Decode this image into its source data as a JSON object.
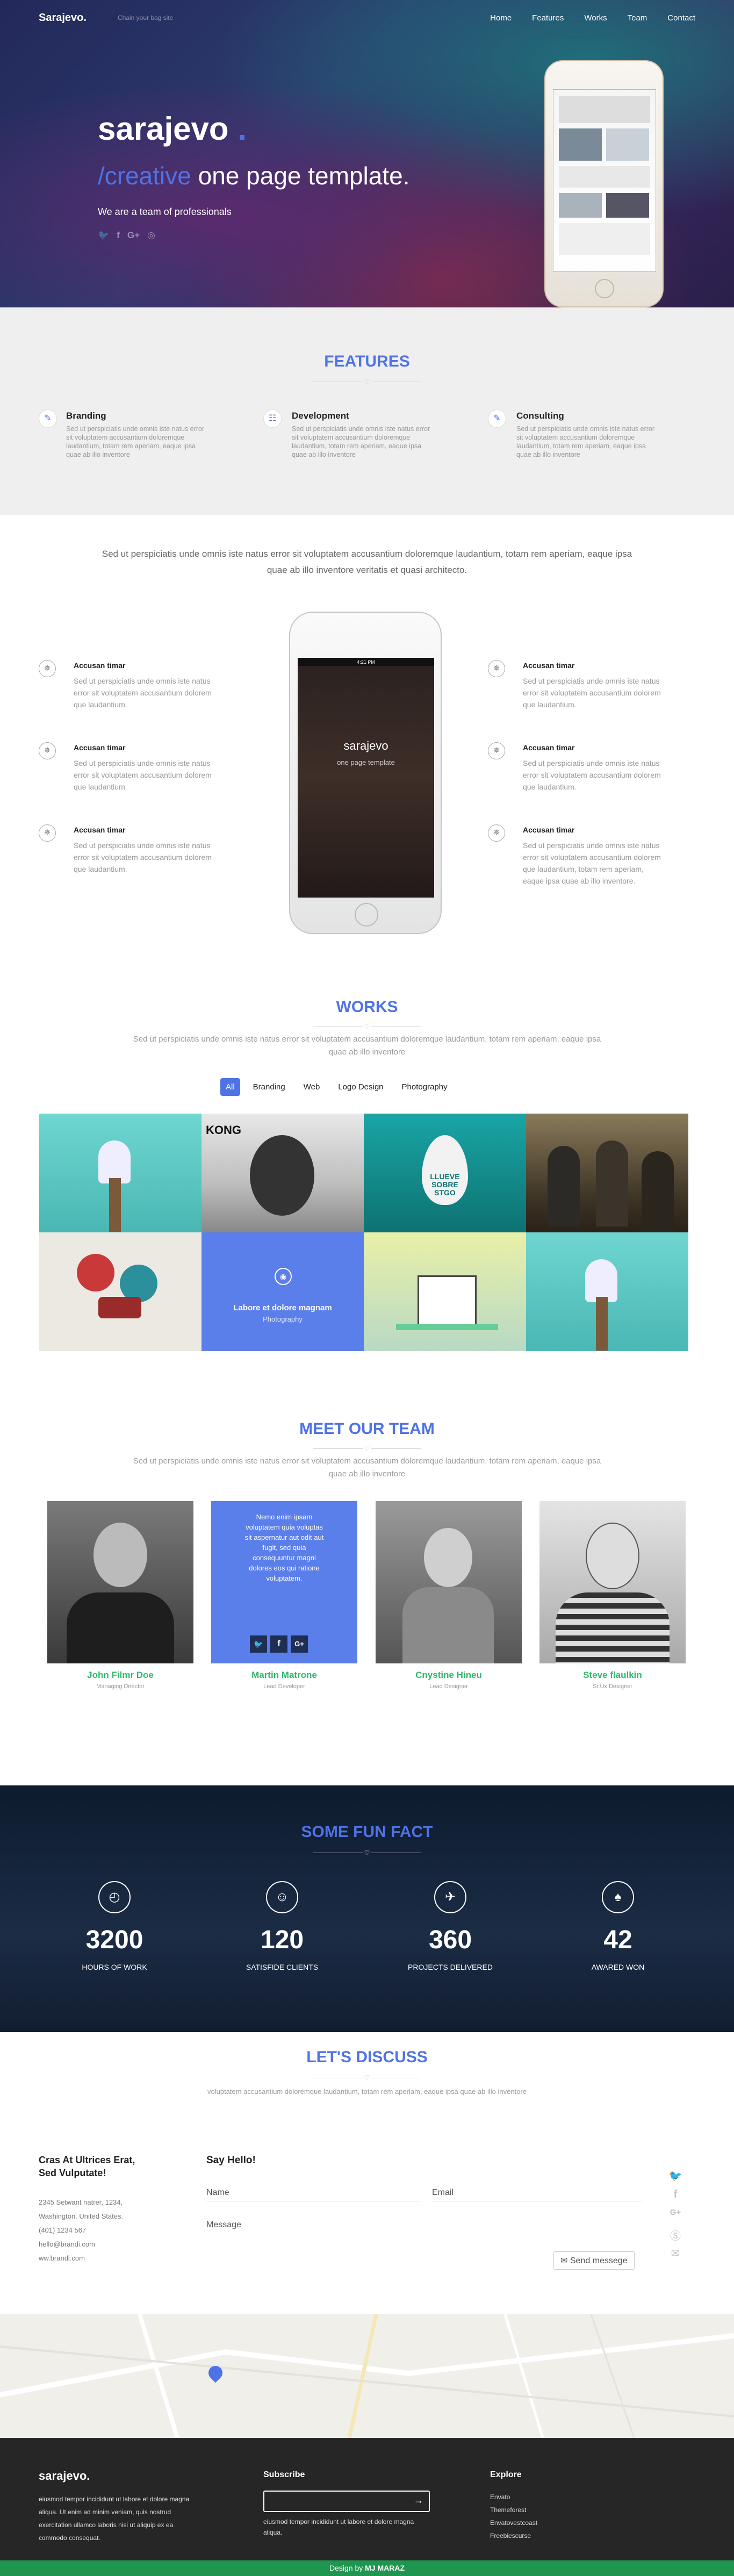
{
  "nav": {
    "brand": "Sarajevo.",
    "tagline": "Chain your bag site",
    "links": [
      "Home",
      "Features",
      "Works",
      "Team",
      "Contact"
    ]
  },
  "hero": {
    "title": "sarajevo",
    "title_dot": ".",
    "subtitle_accent": "/creative",
    "subtitle_rest": " one page template.",
    "tagline": "We are a team of professionals",
    "social_icons": [
      "twitter-icon",
      "facebook-icon",
      "google-plus-icon",
      "dribbble-icon"
    ]
  },
  "features": {
    "heading": "FEATURES",
    "items": [
      {
        "title": "Branding",
        "icon": "pencil-icon",
        "text": "Sed ut perspiciatis unde omnis iste natus error sit voluptatem accusantium doloremque laudantium, totam rem aperiam, eaque ipsa quae ab illo inventore"
      },
      {
        "title": "Development",
        "icon": "database-icon",
        "text": "Sed ut perspiciatis unde omnis iste natus error sit voluptatem accusantium doloremque laudantium, totam rem aperiam, eaque ipsa quae ab illo inventore"
      },
      {
        "title": "Consulting",
        "icon": "pencil-icon",
        "text": "Sed ut perspiciatis unde omnis iste natus error sit voluptatem accusantium doloremque laudantium, totam rem aperiam, eaque ipsa quae ab illo inventore"
      }
    ]
  },
  "showcase": {
    "intro": "Sed ut perspiciatis unde omnis iste natus error sit voluptatem accusantium doloremque laudantium, totam rem aperiam, eaque ipsa quae ab illo inventore veritatis et quasi architecto.",
    "phone_brand": "sarajevo",
    "phone_sub": "one page template",
    "left": [
      {
        "title": "Accusan timar",
        "text": "Sed ut perspiciatis unde omnis iste natus error sit voluptatem accusantium dolorem que laudantium."
      },
      {
        "title": "Accusan timar",
        "text": "Sed ut perspiciatis unde omnis iste natus error sit voluptatem accusantium dolorem que laudantium."
      },
      {
        "title": "Accusan timar",
        "text": "Sed ut perspiciatis unde omnis iste natus error sit voluptatem accusantium dolorem que laudantium."
      }
    ],
    "right": [
      {
        "title": "Accusan timar",
        "text": "Sed ut perspiciatis unde omnis iste natus error sit voluptatem accusantium dolorem que laudantium."
      },
      {
        "title": "Accusan timar",
        "text": "Sed ut perspiciatis unde omnis iste natus error sit voluptatem accusantium dolorem que laudantium."
      },
      {
        "title": "Accusan timar",
        "text": "Sed ut perspiciatis unde omnis iste natus error sit voluptatem accusantium dolorem que laudantium, totam rem aperiam, eaque ipsa quae ab illo inventore."
      }
    ]
  },
  "works": {
    "heading": "WORKS",
    "intro": "Sed ut perspiciatis unde omnis iste natus error sit voluptatem accusantium doloremque laudantium, totam rem aperiam, eaque ipsa quae ab illo inventore",
    "filters": [
      "All",
      "Branding",
      "Web",
      "Logo Design",
      "Photography"
    ],
    "hover_title": "Labore et dolore magnam",
    "hover_cat": "Photography",
    "tile_text_llueve": "LLUEVE SOBRE STGO"
  },
  "team": {
    "heading": "MEET OUR TEAM",
    "intro": "Sed ut perspiciatis unde omnis iste natus error sit voluptatem accusantium doloremque laudantium, totam rem aperiam, eaque ipsa quae ab illo inventore",
    "overlay_text": "Nemo enim ipsam voluptatem quia voluptas sit aspernatur aut odit aut fugit, sed quia consequuntur magni dolores eos qui ratione voluptatem.",
    "members": [
      {
        "name": "John Filmr Doe",
        "role": "Managing Director"
      },
      {
        "name": "Martin Matrone",
        "role": "Lead Developer"
      },
      {
        "name": "Cnystine Hineu",
        "role": "Lead Designer"
      },
      {
        "name": "Steve flaulkin",
        "role": "Sr.Ux Designer"
      }
    ]
  },
  "fact": {
    "heading": "SOME FUN FACT",
    "items": [
      {
        "icon": "clock-icon",
        "value": "3200",
        "label": "HOURS OF WORK"
      },
      {
        "icon": "user-icon",
        "value": "120",
        "label": "SATISFIDE CLIENTS"
      },
      {
        "icon": "rocket-icon",
        "value": "360",
        "label": "PROJECTS DELIVERED"
      },
      {
        "icon": "trophy-icon",
        "value": "42",
        "label": "AWARED WON"
      }
    ]
  },
  "contact": {
    "heading": "LET'S DISCUSS",
    "intro": "voluptatem accusantium doloremque laudantium, totam rem aperiam, eaque ipsa quae ab illo inventore",
    "company_line1": "Cras At Ultrices Erat,",
    "company_line2": "Sed Vulputate!",
    "address": [
      "2345 Setwant natrer, 1234,",
      "Washington. United States.",
      "(401) 1234 567",
      "hello@brandi.com",
      "ww.brandi.com"
    ],
    "form_title": "Say Hello!",
    "name_placeholder": "Name",
    "email_placeholder": "Email",
    "message_placeholder": "Message",
    "send_label": "Send messege"
  },
  "footer": {
    "brand": "sarajevo.",
    "about": "eiusmod tempor incididunt ut labore et dolore magna aliqua. Ut enim ad minim veniam, quis nostrud exercitation ullamco laboris nisi ut aliquip ex ea commodo consequat.",
    "subscribe_heading": "Subscribe",
    "subscribe_text": "eiusmod tempor incididunt ut labore et dolore magna aliqua.",
    "explore_heading": "Explore",
    "explore_links": [
      "Envato",
      "Themeforest",
      "Envatovestcoast",
      "Freebiescurse"
    ],
    "credit_prefix": "Design by",
    "credit_name": "MJ MARAZ"
  },
  "colors": {
    "accent": "#4f73e6",
    "green": "#2eb86b",
    "footer_bg": "#262626"
  }
}
